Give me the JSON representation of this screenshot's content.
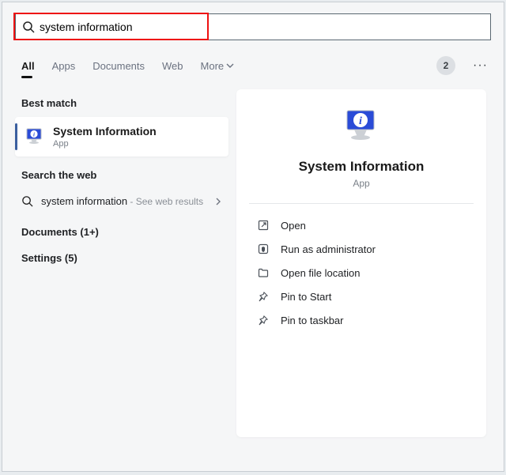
{
  "search": {
    "value": "system information"
  },
  "tabs": {
    "all": "All",
    "apps": "Apps",
    "documents": "Documents",
    "web": "Web",
    "more": "More"
  },
  "count_badge": "2",
  "left": {
    "best_match_header": "Best match",
    "best_match": {
      "title": "System Information",
      "subtitle": "App"
    },
    "search_web_header": "Search the web",
    "web_query": "system information",
    "web_hint": " - See web results",
    "documents_line": "Documents (1+)",
    "settings_line": "Settings (5)"
  },
  "panel": {
    "title": "System Information",
    "subtitle": "App",
    "actions": {
      "open": "Open",
      "run_admin": "Run as administrator",
      "open_loc": "Open file location",
      "pin_start": "Pin to Start",
      "pin_taskbar": "Pin to taskbar"
    }
  }
}
